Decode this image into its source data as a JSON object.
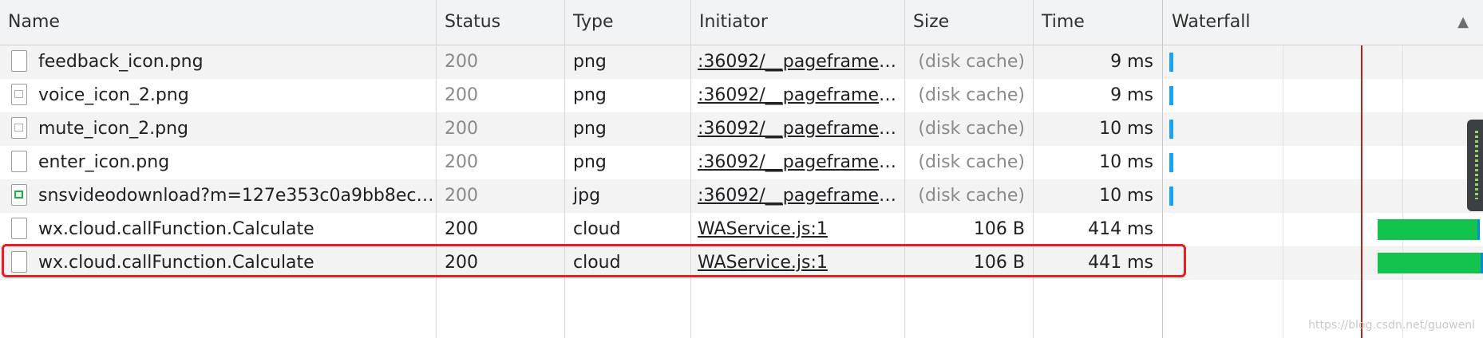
{
  "header": {
    "columns": [
      "Name",
      "Status",
      "Type",
      "Initiator",
      "Size",
      "Time",
      "Waterfall"
    ],
    "sort_indicator": "▲"
  },
  "rows": [
    {
      "name": "feedback_icon.png",
      "status": "200",
      "type": "png",
      "initiator": ":36092/__pageframe__...",
      "size": "(disk cache)",
      "time": "9 ms",
      "icon": "blank-file-icon",
      "dim": true
    },
    {
      "name": "voice_icon_2.png",
      "status": "200",
      "type": "png",
      "initiator": ":36092/__pageframe__...",
      "size": "(disk cache)",
      "time": "9 ms",
      "icon": "image-file-icon",
      "dim": true
    },
    {
      "name": "mute_icon_2.png",
      "status": "200",
      "type": "png",
      "initiator": ":36092/__pageframe__...",
      "size": "(disk cache)",
      "time": "10 ms",
      "icon": "image-file-icon",
      "dim": true
    },
    {
      "name": "enter_icon.png",
      "status": "200",
      "type": "png",
      "initiator": ":36092/__pageframe__...",
      "size": "(disk cache)",
      "time": "10 ms",
      "icon": "blank-file-icon",
      "dim": true
    },
    {
      "name": "snsvideodownload?m=127e353c0a9bb8ec6...",
      "status": "200",
      "type": "jpg",
      "initiator": ":36092/__pageframe__...",
      "size": "(disk cache)",
      "time": "10 ms",
      "icon": "jpg-file-icon",
      "dim": true
    },
    {
      "name": "wx.cloud.callFunction.Calculate",
      "status": "200",
      "type": "cloud",
      "initiator": "WAService.js:1",
      "size": "106 B",
      "time": "414 ms",
      "icon": "blank-file-icon",
      "dim": false
    },
    {
      "name": "wx.cloud.callFunction.Calculate",
      "status": "200",
      "type": "cloud",
      "initiator": "WAService.js:1",
      "size": "106 B",
      "time": "441 ms",
      "icon": "blank-file-icon",
      "dim": false
    }
  ],
  "colors": {
    "highlight": "#ec1c24",
    "waiting_bar": "#12c44e",
    "cache_bar": "#1aa3f0",
    "load_marker": "#b3261e"
  },
  "watermark": "https://blog.csdn.net/guowenl"
}
